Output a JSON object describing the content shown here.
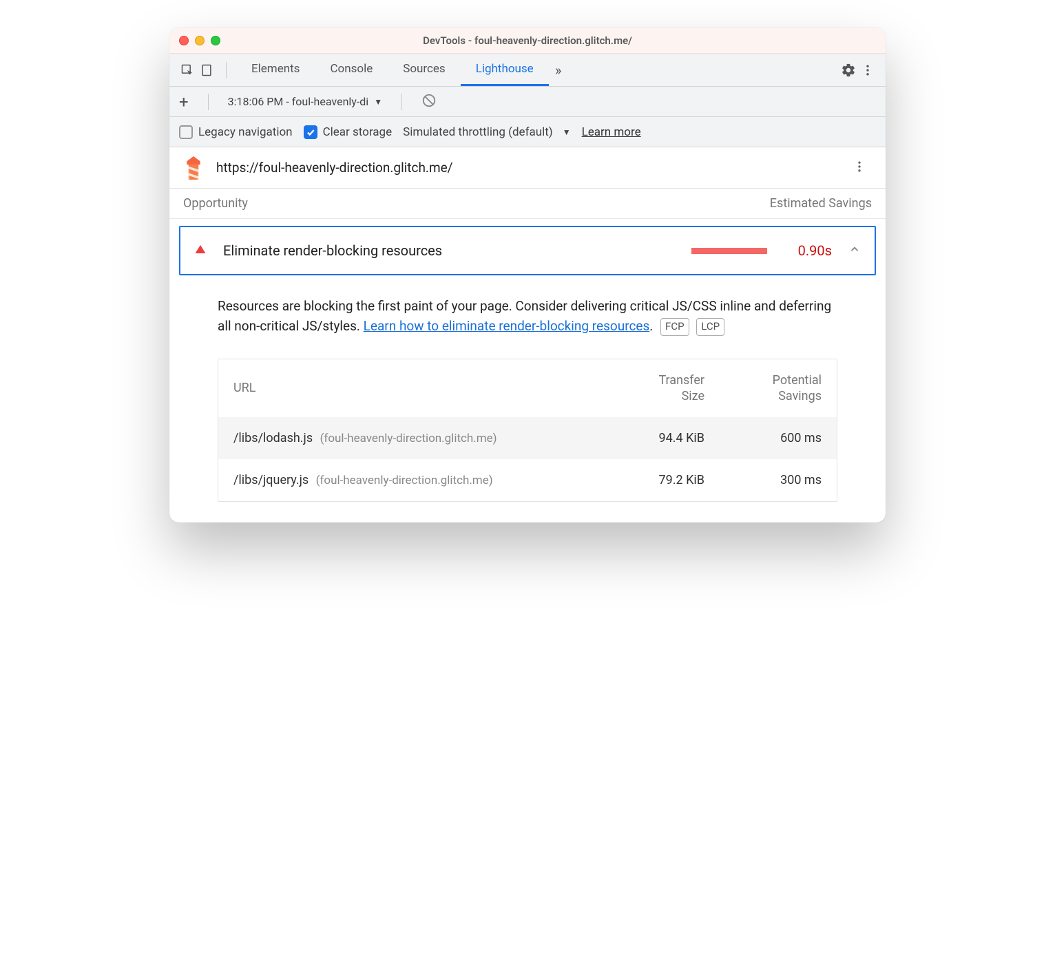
{
  "window": {
    "title": "DevTools - foul-heavenly-direction.glitch.me/"
  },
  "tabs": {
    "items": [
      "Elements",
      "Console",
      "Sources",
      "Lighthouse"
    ],
    "active": "Lighthouse"
  },
  "toolbar2": {
    "run_label": "3:18:06 PM - foul-heavenly-di"
  },
  "toolbar3": {
    "legacy_label": "Legacy navigation",
    "legacy_checked": false,
    "clear_label": "Clear storage",
    "clear_checked": true,
    "throttle_label": "Simulated throttling (default)",
    "learn_more": "Learn more"
  },
  "report": {
    "url": "https://foul-heavenly-direction.glitch.me/"
  },
  "opportunity": {
    "section_label": "Opportunity",
    "savings_label": "Estimated Savings",
    "title": "Eliminate render-blocking resources",
    "value": "0.90s",
    "description_pre": "Resources are blocking the first paint of your page. Consider delivering critical JS/CSS inline and deferring all non-critical JS/styles. ",
    "description_link": "Learn how to eliminate render-blocking resources",
    "description_post": ".",
    "tags": [
      "FCP",
      "LCP"
    ]
  },
  "table": {
    "headers": {
      "url": "URL",
      "size1": "Transfer",
      "size2": "Size",
      "save1": "Potential",
      "save2": "Savings"
    },
    "rows": [
      {
        "path": "/libs/lodash.js",
        "origin": "(foul-heavenly-direction.glitch.me)",
        "size": "94.4 KiB",
        "savings": "600 ms"
      },
      {
        "path": "/libs/jquery.js",
        "origin": "(foul-heavenly-direction.glitch.me)",
        "size": "79.2 KiB",
        "savings": "300 ms"
      }
    ]
  }
}
